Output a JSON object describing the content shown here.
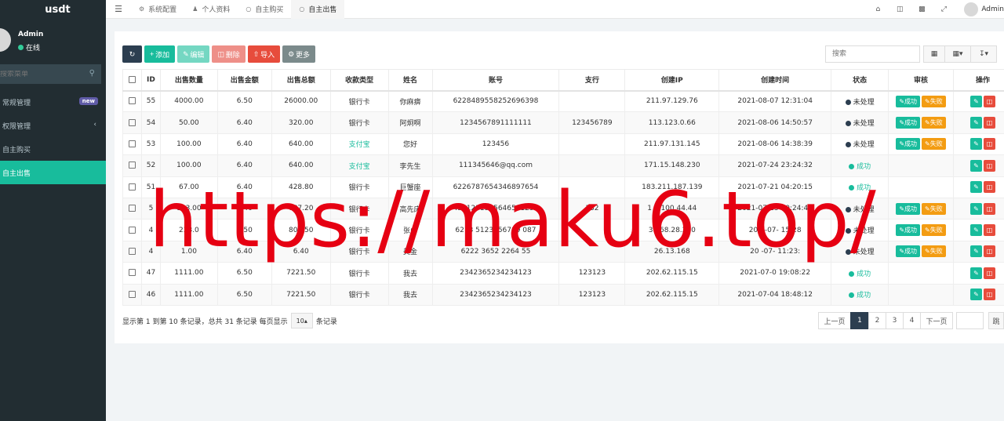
{
  "app": {
    "brand": "usdt"
  },
  "sidebar": {
    "user_name": "Admin",
    "user_status": "在线",
    "search_placeholder": "搜索菜单",
    "items": [
      {
        "label": "常规管理",
        "badge": "new"
      },
      {
        "label": "权限管理",
        "chevron": "‹"
      },
      {
        "label": "自主购买"
      },
      {
        "label": "自主出售"
      }
    ]
  },
  "topbar": {
    "tabs": [
      {
        "icon": "gear-icon",
        "glyph": "⚙",
        "label": "系统配置"
      },
      {
        "icon": "user-icon",
        "glyph": "♟",
        "label": "个人资料"
      },
      {
        "icon": "circle-icon",
        "glyph": "○",
        "label": "自主购买"
      },
      {
        "icon": "circle-icon",
        "glyph": "○",
        "label": "自主出售"
      }
    ],
    "user": "Admin"
  },
  "toolbar": {
    "add": "添加",
    "edit": "编辑",
    "delete": "删除",
    "import": "导入",
    "more": "更多",
    "search_placeholder": "搜索"
  },
  "table": {
    "headers": [
      "ID",
      "出售数量",
      "出售金额",
      "出售总额",
      "收款类型",
      "姓名",
      "账号",
      "支行",
      "创建IP",
      "创建时间",
      "状态",
      "审核",
      "操作"
    ],
    "rows": [
      {
        "id": "55",
        "qty": "4000.00",
        "price": "6.50",
        "total": "26000.00",
        "type": "银行卡",
        "name": "你麻痹",
        "account": "6228489558252696398",
        "branch": "",
        "ip": "211.97.129.76",
        "time": "2021-08-07 12:31:04",
        "status": "未处理"
      },
      {
        "id": "54",
        "qty": "50.00",
        "price": "6.40",
        "total": "320.00",
        "type": "银行卡",
        "name": "阿炯啊",
        "account": "1234567891111111",
        "branch": "123456789",
        "ip": "113.123.0.66",
        "time": "2021-08-06 14:50:57",
        "status": "未处理"
      },
      {
        "id": "53",
        "qty": "100.00",
        "price": "6.40",
        "total": "640.00",
        "type": "支付宝",
        "name": "您好",
        "account": "123456",
        "branch": "",
        "ip": "211.97.131.145",
        "time": "2021-08-06 14:38:39",
        "status": "未处理"
      },
      {
        "id": "52",
        "qty": "100.00",
        "price": "6.40",
        "total": "640.00",
        "type": "支付宝",
        "name": "李先生",
        "account": "111345646@qq.com",
        "branch": "",
        "ip": "171.15.148.230",
        "time": "2021-07-24 23:24:32",
        "status": "成功"
      },
      {
        "id": "51",
        "qty": "67.00",
        "price": "6.40",
        "total": "428.80",
        "type": "银行卡",
        "name": "巨蟹座",
        "account": "6226787654346897654",
        "branch": "",
        "ip": "183.211.187.139",
        "time": "2021-07-21 04:20:15",
        "status": "成功"
      },
      {
        "id": "5",
        "qty": "123.00",
        "price": "6.40",
        "total": "787.20",
        "type": "银行卡",
        "name": "高先床",
        "account": "4561231345646541256",
        "branch": "132",
        "ip": "1 8.100.44.44",
        "time": "2021-07-15 20:24:42",
        "status": "未处理"
      },
      {
        "id": "4",
        "qty": "233.0",
        "price": "6.50",
        "total": "801 50",
        "type": "银行卡",
        "name": "张山",
        "account": "6213 5123456789 087",
        "branch": "",
        "ip": "3.168.28.240",
        "time": "202 -07-  15:28",
        "status": "未处理"
      },
      {
        "id": "4",
        "qty": "1.00",
        "price": "6.40",
        "total": "6.40",
        "type": "银行卡",
        "name": "美金",
        "account": "6222 3652  2264 55",
        "branch": "",
        "ip": " 26.13.168",
        "time": "20 -07-  11:23:",
        "status": "未处理"
      },
      {
        "id": "47",
        "qty": "1111.00",
        "price": "6.50",
        "total": "7221.50",
        "type": "银行卡",
        "name": "我去",
        "account": "2342365234234123",
        "branch": "123123",
        "ip": "202.62.115.15",
        "time": "2021-07-0  19:08:22",
        "status": "成功"
      },
      {
        "id": "46",
        "qty": "1111.00",
        "price": "6.50",
        "total": "7221.50",
        "type": "银行卡",
        "name": "我去",
        "account": "2342365234234123",
        "branch": "123123",
        "ip": "202.62.115.15",
        "time": "2021-07-04 18:48:12",
        "status": "成功"
      }
    ],
    "audit_ok": "成功",
    "audit_fail": "失败"
  },
  "footer": {
    "info": "显示第 1 到第 10 条记录，总共 31 条记录 每页显示",
    "page_size": "10",
    "suffix": "条记录",
    "prev": "上一页",
    "pages": [
      "1",
      "2",
      "3",
      "4"
    ],
    "next": "下一页",
    "go": "跳"
  },
  "watermark": "https://maku6.top/",
  "colors": {
    "sidebar": "#222d32",
    "accent": "#18bc9c",
    "danger": "#e74c3c",
    "warning": "#f39c12",
    "watermark": "#e60012"
  }
}
